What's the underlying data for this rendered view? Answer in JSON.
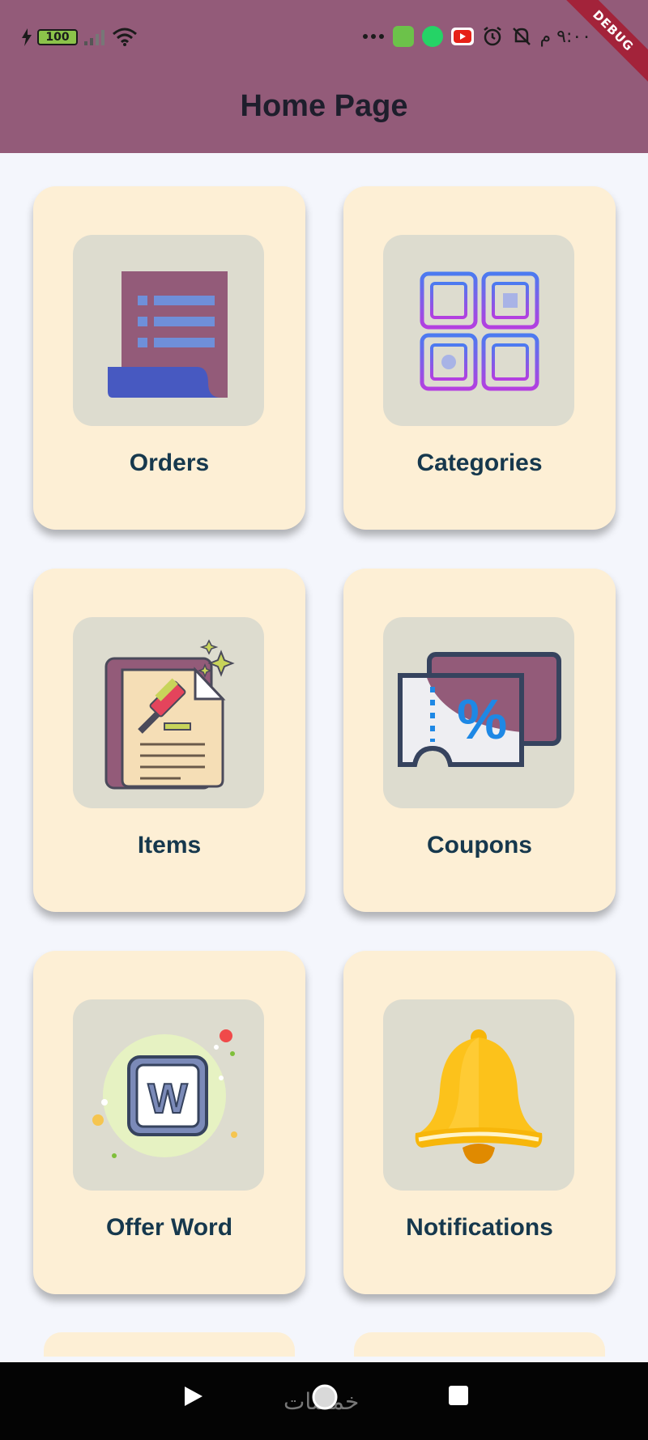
{
  "status_bar": {
    "battery": "100",
    "time": "٩:٠٠ م",
    "debug_banner": "DEBUG"
  },
  "appbar": {
    "title": "Home Page"
  },
  "tiles": [
    {
      "label": "Orders",
      "icon": "document-list-icon"
    },
    {
      "label": "Categories",
      "icon": "categories-grid-icon"
    },
    {
      "label": "Items",
      "icon": "gavel-document-icon"
    },
    {
      "label": "Coupons",
      "icon": "coupon-percent-icon"
    },
    {
      "label": "Offer Word",
      "icon": "word-badge-icon"
    },
    {
      "label": "Notifications",
      "icon": "bell-icon"
    }
  ],
  "navbar": {
    "watermark": "خمسات"
  },
  "colors": {
    "appbar": "#935b79",
    "card": "#fdefd5",
    "icon_box": "#dddccf",
    "label": "#16384d"
  }
}
